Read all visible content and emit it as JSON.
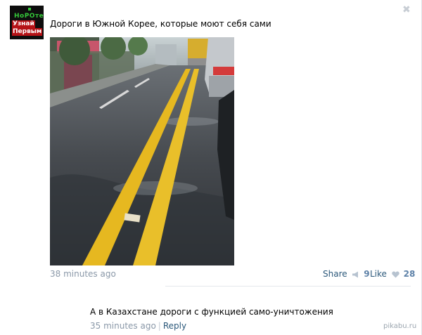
{
  "post": {
    "author_avatar": {
      "top_text": "НоРОте",
      "line1": "Узнай",
      "line2": "Первым"
    },
    "title": "Дороги в Южной Корее, которые моют себя сами",
    "time": "38 minutes ago",
    "share_label": "Share",
    "share_count": "9",
    "like_label": "Like",
    "like_count": "28"
  },
  "comment": {
    "text": "А в Казахстане дороги с функцией само-уничтожения",
    "time": "35 minutes ago",
    "separator": "|",
    "reply_label": "Reply"
  },
  "watermark": "pikabu.ru",
  "colors": {
    "link": "#2b587a",
    "meta": "#8a98a8",
    "count": "#5e82a8",
    "road_line": "#e6b820"
  }
}
